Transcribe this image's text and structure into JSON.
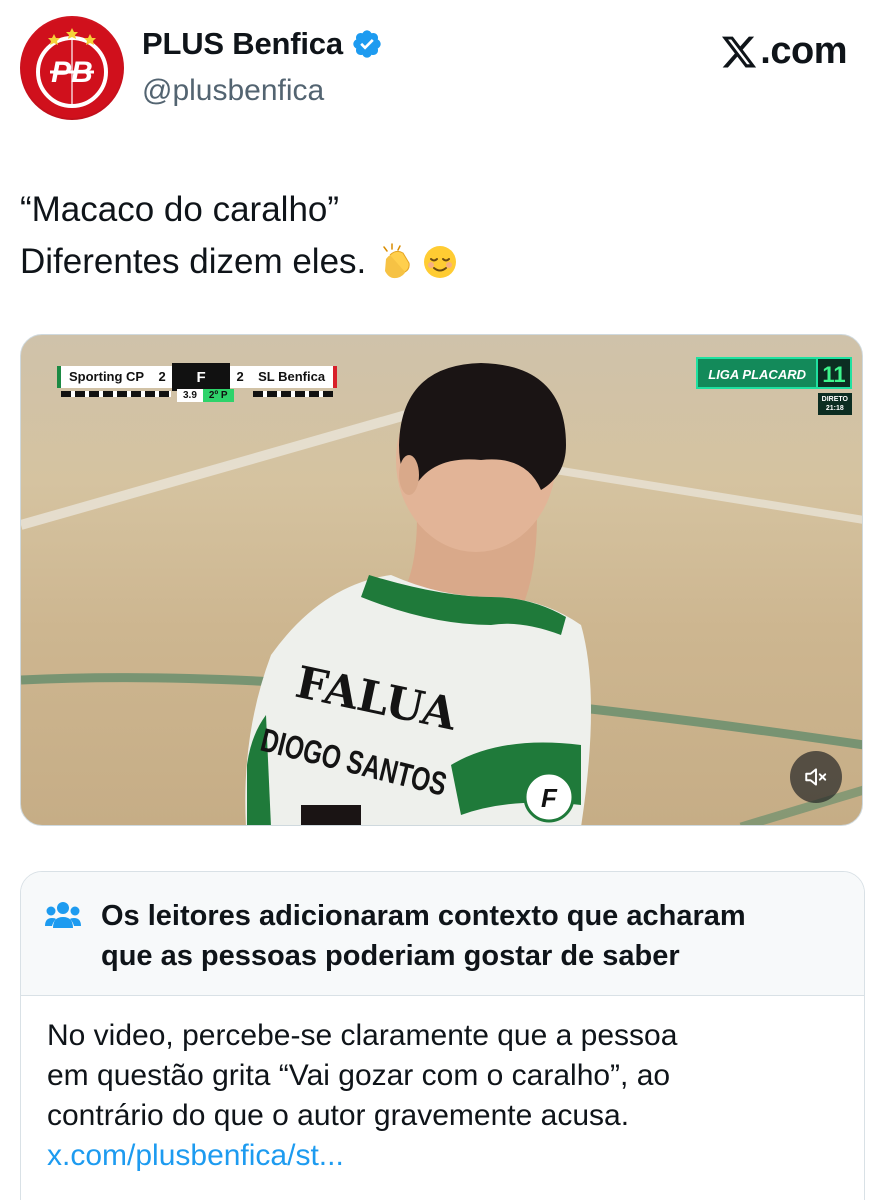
{
  "author": {
    "display_name": "PLUS Benfica",
    "handle": "@plusbenfica",
    "avatar_initials": "PB",
    "verified_icon": "verified-badge-icon"
  },
  "brand": {
    "label": ".com",
    "icon": "x-logo-icon"
  },
  "tweet": {
    "line1": "“Macaco do caralho”",
    "line2": "Diferentes dizem eles.",
    "emojis": [
      "clapping-hands-emoji",
      "relieved-face-emoji"
    ]
  },
  "video": {
    "scoreboard": {
      "home_team": "Sporting CP",
      "home_score": "2",
      "away_team": "SL Benfica",
      "away_score": "2",
      "clock": "3.9",
      "period": "2º P",
      "league_logo": "F"
    },
    "broadcast": {
      "channel": "LIGA PLACARD",
      "channel_number": "11",
      "live_label": "DIRETO",
      "live_time": "21:18"
    },
    "jersey": {
      "sponsor": "FALUA",
      "player_name": "DIOGO SANTOS"
    },
    "mute_icon": "speaker-muted-icon"
  },
  "community_note": {
    "title_line1": "Os leitores adicionaram contexto que acharam",
    "title_line2": "que as pessoas poderiam gostar de saber",
    "body_line1": "No video, percebe-se claramente que a pessoa",
    "body_line2": "em questão grita “Vai gozar com o caralho”, ao",
    "body_line3": "contrário do que o autor gravemente acusa.",
    "link": "x.com/plusbenfica/st...",
    "icon": "people-icon"
  },
  "colors": {
    "text": "#0f1419",
    "secondary": "#536471",
    "link": "#1d9bf0",
    "verified": "#1d9bf0",
    "benfica_red": "#d0101c",
    "sporting_green": "#1f8a3f"
  }
}
